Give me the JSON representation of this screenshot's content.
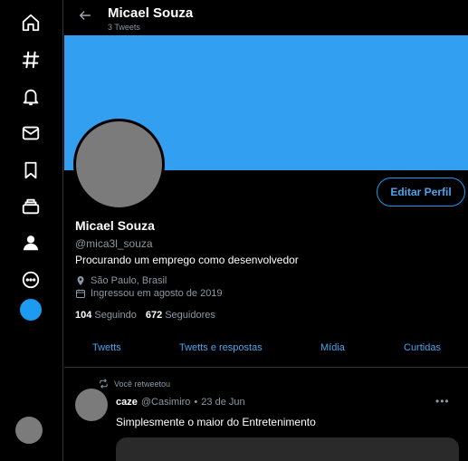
{
  "nav": {
    "items": [
      {
        "icon": "home-icon"
      },
      {
        "icon": "hashtag-icon"
      },
      {
        "icon": "bell-icon"
      },
      {
        "icon": "mail-icon"
      },
      {
        "icon": "bookmark-icon"
      },
      {
        "icon": "lists-icon"
      },
      {
        "icon": "profile-icon"
      },
      {
        "icon": "more-icon"
      }
    ]
  },
  "header": {
    "name": "Micael Souza",
    "tweet_count": "3 Tweets"
  },
  "colors": {
    "banner": "#339ff0",
    "accent": "#1d9bf0"
  },
  "profile": {
    "name": "Micael Souza",
    "handle": "@mica3l_souza",
    "bio": "Procurando um emprego como desenvolvedor",
    "location": "São Paulo, Brasil",
    "joined": "Ingressou em agosto de 2019",
    "following_count": "104",
    "following_label": "Seguindo",
    "followers_count": "672",
    "followers_label": "Seguidores",
    "edit_label": "Editar Perfil"
  },
  "tabs": [
    "Twetts",
    "Twetts e respostas",
    "Mídia",
    "Curtidas"
  ],
  "tweet": {
    "retweet_label": "Você retweetou",
    "author_name": "caze",
    "author_handle": "@Casimiro",
    "separator": "•",
    "date": "23 de Jun",
    "more": "•••",
    "text": "Simplesmente o maior do Entretenimento"
  }
}
